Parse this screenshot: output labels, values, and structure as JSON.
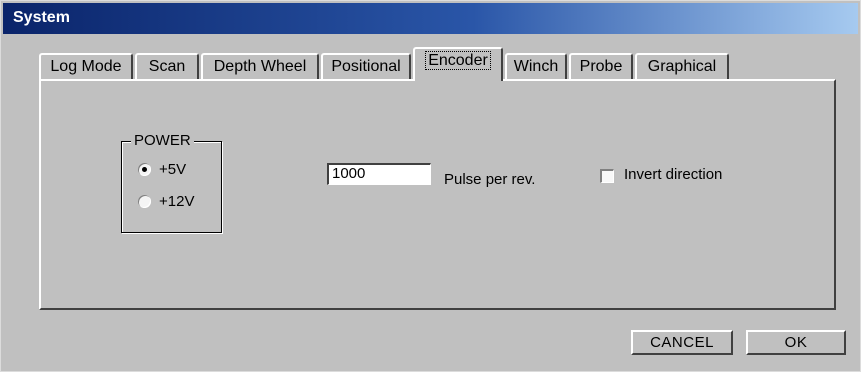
{
  "window": {
    "title": "System"
  },
  "tabs": [
    {
      "label": "Log Mode",
      "active": false
    },
    {
      "label": "Scan",
      "active": false
    },
    {
      "label": "Depth Wheel",
      "active": false
    },
    {
      "label": "Positional",
      "active": false
    },
    {
      "label": "Encoder",
      "active": true
    },
    {
      "label": "Winch",
      "active": false
    },
    {
      "label": "Probe",
      "active": false
    },
    {
      "label": "Graphical",
      "active": false
    }
  ],
  "encoder": {
    "power_group": {
      "title": "POWER",
      "options": [
        {
          "label": "+5V",
          "selected": true
        },
        {
          "label": "+12V",
          "selected": false
        }
      ]
    },
    "pulse_field": {
      "value": "1000",
      "label": "Pulse per rev."
    },
    "invert_direction": {
      "label": "Invert direction",
      "checked": false
    }
  },
  "buttons": {
    "cancel": "CANCEL",
    "ok": "OK"
  }
}
